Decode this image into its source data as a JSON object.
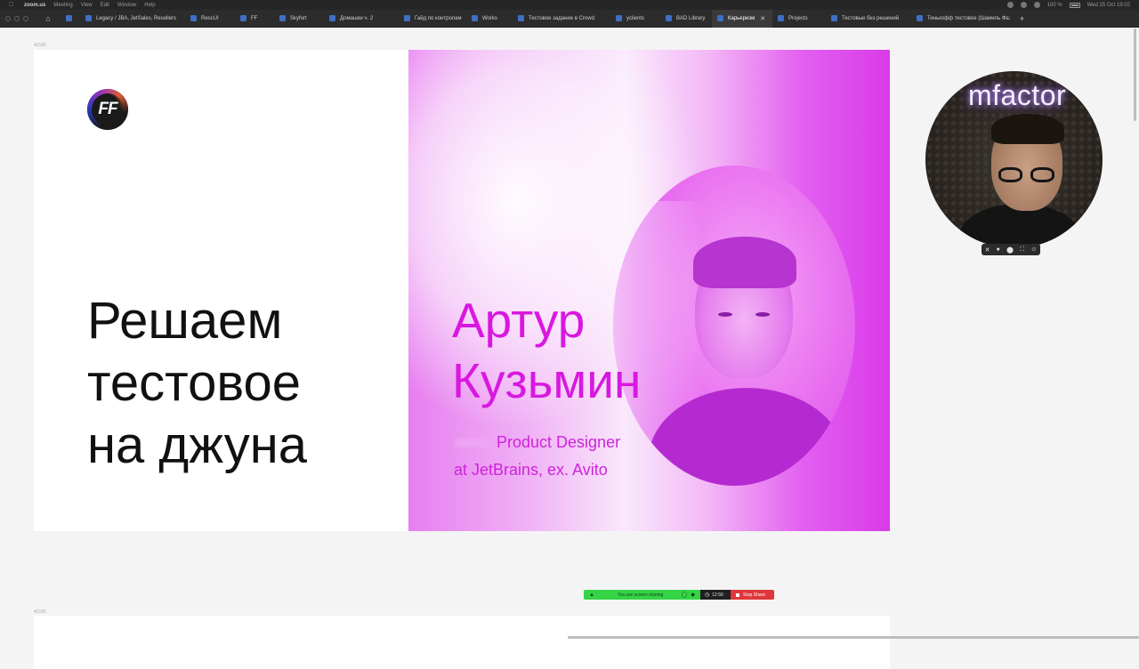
{
  "menubar": {
    "app": "zoom.us",
    "items": [
      "Meeting",
      "View",
      "Edit",
      "Window",
      "Help"
    ],
    "battery": "100 %",
    "clock": "Wed 25 Oct 19:02"
  },
  "tabs": [
    {
      "label": ""
    },
    {
      "label": "Legacy / JBA, JetSales, Resellers"
    },
    {
      "label": "RescUI"
    },
    {
      "label": "FF"
    },
    {
      "label": "Skyfort"
    },
    {
      "label": "Домашки ч. 2"
    },
    {
      "label": "Гайд по контролам"
    },
    {
      "label": "Works"
    },
    {
      "label": "Тестовое задание в Crowd"
    },
    {
      "label": "yclients"
    },
    {
      "label": "BAD Library"
    },
    {
      "label": "Карьеризм",
      "active": true
    },
    {
      "label": "Projects"
    },
    {
      "label": "Тестовые без решений"
    },
    {
      "label": "Тинькофф тестовое (Шамиль Фа:"
    }
  ],
  "canvas": {
    "frame_label_top": "42165",
    "frame_label_bottom": "42165"
  },
  "slide": {
    "logo_text": "FF",
    "headline": [
      "Решаем",
      "тестовое",
      "на джуна"
    ],
    "speaker_name": [
      "Артур",
      "Кузьмин"
    ],
    "speaker_role": [
      "Product Designer",
      "at JetBrains, ex. Avito"
    ]
  },
  "webcam": {
    "neon_text": "mfactor"
  },
  "share_bar": {
    "status": "You are screen sharing",
    "timer": "12:50",
    "stop": "Stop Share"
  },
  "colors": {
    "accent_magenta": "#d818e0",
    "share_green": "#35d446",
    "stop_red": "#e0363b"
  }
}
